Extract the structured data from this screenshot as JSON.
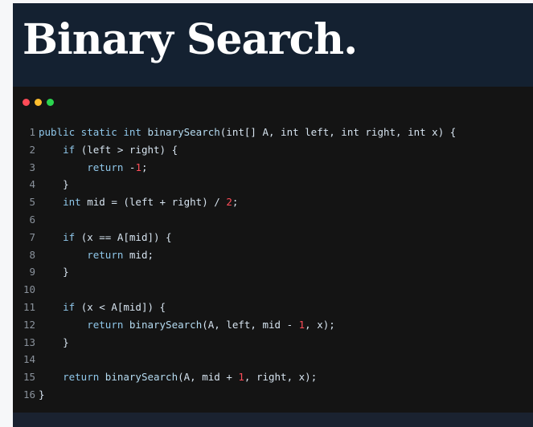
{
  "header": {
    "title": "Binary Search."
  },
  "window_controls": [
    "close",
    "minimize",
    "maximize"
  ],
  "colors": {
    "background": "#111823",
    "header_bg": "#142131",
    "editor_bg": "#141414",
    "text": "#d6e3ef",
    "keyword": "#8fc7ea",
    "number": "#ff4d59",
    "line_number": "#8a929c",
    "dot_red": "#ff4b57",
    "dot_yellow": "#ffbe2e",
    "dot_green": "#2bd54f"
  },
  "code": {
    "lines": [
      {
        "n": "1",
        "tokens": [
          [
            "kw",
            "public static int "
          ],
          [
            "fn",
            "binarySearch"
          ],
          [
            "t",
            "(int[] A, int left, int right, int x) {"
          ]
        ]
      },
      {
        "n": "2",
        "tokens": [
          [
            "t",
            "    "
          ],
          [
            "kw",
            "if"
          ],
          [
            "t",
            " (left > right) {"
          ]
        ]
      },
      {
        "n": "3",
        "tokens": [
          [
            "t",
            "        "
          ],
          [
            "kw",
            "return"
          ],
          [
            "t",
            " -"
          ],
          [
            "num",
            "1"
          ],
          [
            "t",
            ";"
          ]
        ]
      },
      {
        "n": "4",
        "tokens": [
          [
            "t",
            "    }"
          ]
        ]
      },
      {
        "n": "5",
        "tokens": [
          [
            "t",
            "    "
          ],
          [
            "kw",
            "int"
          ],
          [
            "t",
            " mid = (left + right) / "
          ],
          [
            "num",
            "2"
          ],
          [
            "t",
            ";"
          ]
        ]
      },
      {
        "n": "6",
        "tokens": [
          [
            "t",
            ""
          ]
        ]
      },
      {
        "n": "7",
        "tokens": [
          [
            "t",
            "    "
          ],
          [
            "kw",
            "if"
          ],
          [
            "t",
            " (x == A[mid]) {"
          ]
        ]
      },
      {
        "n": "8",
        "tokens": [
          [
            "t",
            "        "
          ],
          [
            "kw",
            "return"
          ],
          [
            "t",
            " mid;"
          ]
        ]
      },
      {
        "n": "9",
        "tokens": [
          [
            "t",
            "    }"
          ]
        ]
      },
      {
        "n": "10",
        "tokens": [
          [
            "t",
            ""
          ]
        ]
      },
      {
        "n": "11",
        "tokens": [
          [
            "t",
            "    "
          ],
          [
            "kw",
            "if"
          ],
          [
            "t",
            " (x < A[mid]) {"
          ]
        ]
      },
      {
        "n": "12",
        "tokens": [
          [
            "t",
            "        "
          ],
          [
            "kw",
            "return"
          ],
          [
            "t",
            " "
          ],
          [
            "fn",
            "binarySearch"
          ],
          [
            "t",
            "(A, left, mid - "
          ],
          [
            "num",
            "1"
          ],
          [
            "t",
            ", x);"
          ]
        ]
      },
      {
        "n": "13",
        "tokens": [
          [
            "t",
            "    }"
          ]
        ]
      },
      {
        "n": "14",
        "tokens": [
          [
            "t",
            ""
          ]
        ]
      },
      {
        "n": "15",
        "tokens": [
          [
            "t",
            "    "
          ],
          [
            "kw",
            "return"
          ],
          [
            "t",
            " "
          ],
          [
            "fn",
            "binarySearch"
          ],
          [
            "t",
            "(A, mid + "
          ],
          [
            "num",
            "1"
          ],
          [
            "t",
            ", right, x);"
          ]
        ]
      },
      {
        "n": "16",
        "tokens": [
          [
            "t",
            "}"
          ]
        ]
      }
    ]
  }
}
